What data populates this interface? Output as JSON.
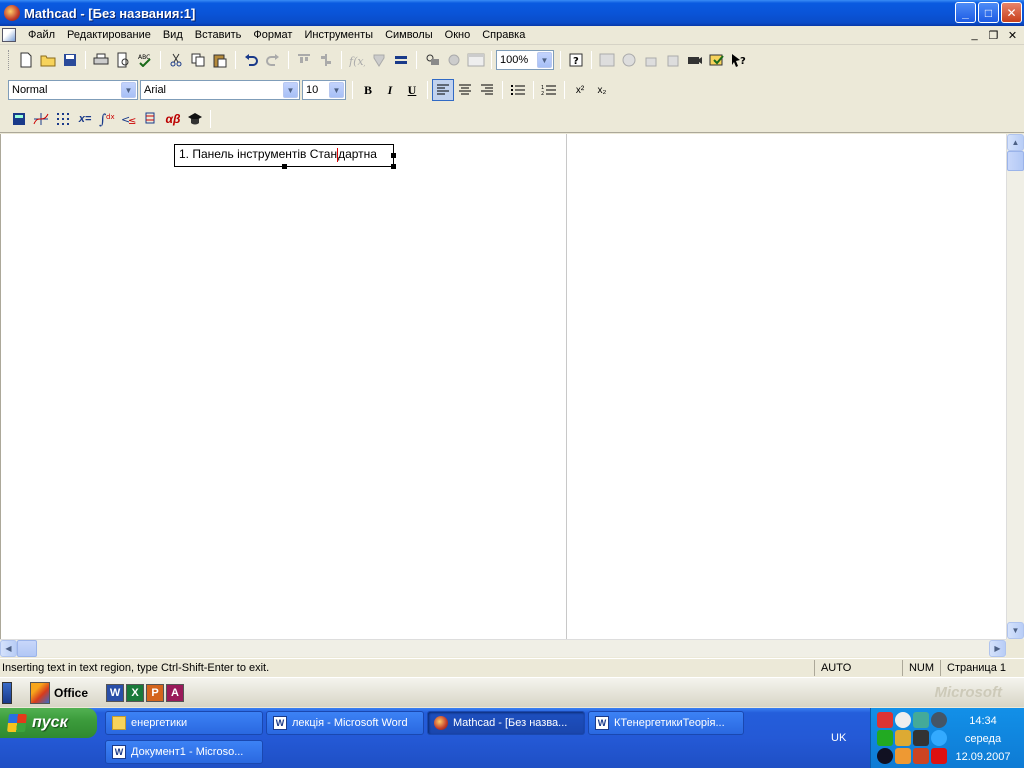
{
  "window": {
    "title": "Mathcad - [Без названия:1]",
    "buttons": {
      "minimize": "_",
      "maximize": "□",
      "close": "✕"
    }
  },
  "menu": {
    "items": [
      "Файл",
      "Редактирование",
      "Вид",
      "Вставить",
      "Формат",
      "Инструменты",
      "Символы",
      "Окно",
      "Справка"
    ],
    "mdi": {
      "minimize": "_",
      "restore": "❐",
      "close": "✕"
    }
  },
  "toolbar_standard": {
    "zoom": "100%",
    "icons": [
      "new-icon",
      "open-icon",
      "save-icon",
      "print-icon",
      "print-preview-icon",
      "spellcheck-icon",
      "cut-icon",
      "copy-icon",
      "paste-icon",
      "undo-icon",
      "redo-icon",
      "align-top-icon",
      "align-bottom-icon",
      "insert-function-icon",
      "insert-unit-icon",
      "calculate-icon",
      "insert-graph-icon",
      "insert-matrix-icon",
      "resource-center-icon",
      "help-icon"
    ]
  },
  "toolbar_formatting": {
    "style": "Normal",
    "font": "Arial",
    "size": "10",
    "bold": "B",
    "italic": "I",
    "underline": "U",
    "superscript": "x²",
    "subscript": "x₂"
  },
  "toolbar_math": {
    "icons": [
      "calculator-icon",
      "graph-icon",
      "matrix-icon",
      "evaluation-icon",
      "calculus-icon",
      "boolean-icon",
      "programming-icon",
      "greek-icon",
      "symbolic-icon"
    ],
    "labels": {
      "evaluation": "x=",
      "greek": "αβ"
    }
  },
  "document": {
    "text_region": "1. Панель інструментів Стандартна",
    "text_before_caret": "1. Панель інструментів Стан",
    "text_after_caret": "дартна"
  },
  "status": {
    "message": "Inserting text in text region, type Ctrl-Shift-Enter to exit.",
    "mode": "AUTO",
    "num": "NUM",
    "page": "Страница 1"
  },
  "officebar": {
    "label": "Office",
    "apps": [
      "W",
      "X",
      "P",
      "A"
    ],
    "watermark": "Microsoft"
  },
  "taskbar": {
    "start": "пуск",
    "tasks": [
      {
        "label": "енергетики",
        "icon": "folder"
      },
      {
        "label": "лекція - Microsoft Word",
        "icon": "word"
      },
      {
        "label": "Mathcad - [Без назва...",
        "icon": "mathcad"
      },
      {
        "label": "КТенергетикиТеорія...",
        "icon": "word"
      },
      {
        "label": "Документ1 - Microso...",
        "icon": "word"
      }
    ],
    "language": "UK",
    "clock": {
      "time": "14:34",
      "day": "середа",
      "date": "12.09.2007"
    }
  },
  "colors": {
    "titlebar": "#0a54d8",
    "taskbar": "#245edb",
    "start": "#3c9c3c",
    "tray": "#0e7bd4",
    "caret": "#dd0000"
  }
}
